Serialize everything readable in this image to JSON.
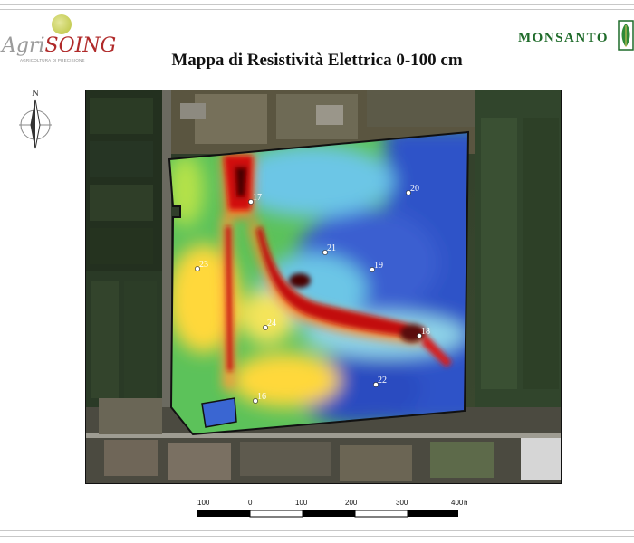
{
  "header": {
    "title": "Mappa di Resistività Elettrica 0-100 cm",
    "logo_left": {
      "brand_prefix": "Agri",
      "brand_main": "SOING",
      "tagline": "AGRICOLTURA DI PRECISIONE"
    },
    "logo_right": {
      "brand": "MONSANTO"
    }
  },
  "compass": {
    "label": "N"
  },
  "map": {
    "points": [
      {
        "id": "17",
        "label": "17"
      },
      {
        "id": "20",
        "label": "20"
      },
      {
        "id": "21",
        "label": "21"
      },
      {
        "id": "19",
        "label": "19"
      },
      {
        "id": "23",
        "label": "23"
      },
      {
        "id": "24",
        "label": "24"
      },
      {
        "id": "18",
        "label": "18"
      },
      {
        "id": "22",
        "label": "22"
      },
      {
        "id": "16",
        "label": "16"
      }
    ]
  },
  "scalebar": {
    "ticks": [
      "100",
      "0",
      "100",
      "200",
      "300",
      "400"
    ],
    "unit": "m"
  }
}
